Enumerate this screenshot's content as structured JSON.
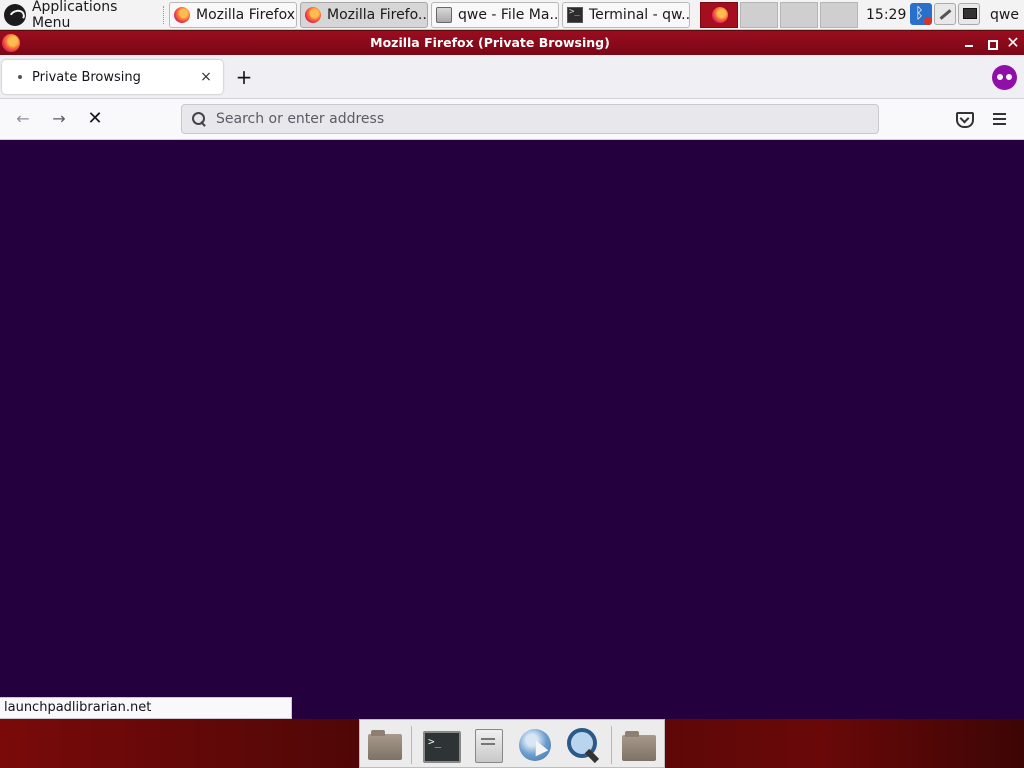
{
  "panel": {
    "app_menu_label": "Applications Menu",
    "tasks": [
      {
        "label": "Mozilla Firefox",
        "icon": "firefox-icon"
      },
      {
        "label": "Mozilla Firefo...",
        "icon": "firefox-icon"
      },
      {
        "label": "qwe - File Ma...",
        "icon": "file-manager-icon"
      },
      {
        "label": "Terminal - qw...",
        "icon": "terminal-icon"
      }
    ],
    "clock": "15:29",
    "user": "qwe"
  },
  "window": {
    "title": "Mozilla Firefox (Private Browsing)"
  },
  "browser": {
    "tab_label": "Private Browsing",
    "new_tab_symbol": "+",
    "close_tab_symbol": "×",
    "url_placeholder": "Search or enter address",
    "url_value": "",
    "status_text": "launchpadlibrarian.net"
  },
  "colors": {
    "content_background": "#25003e",
    "titlebar": "#9a0d1f",
    "private_badge": "#8f0fa8"
  }
}
